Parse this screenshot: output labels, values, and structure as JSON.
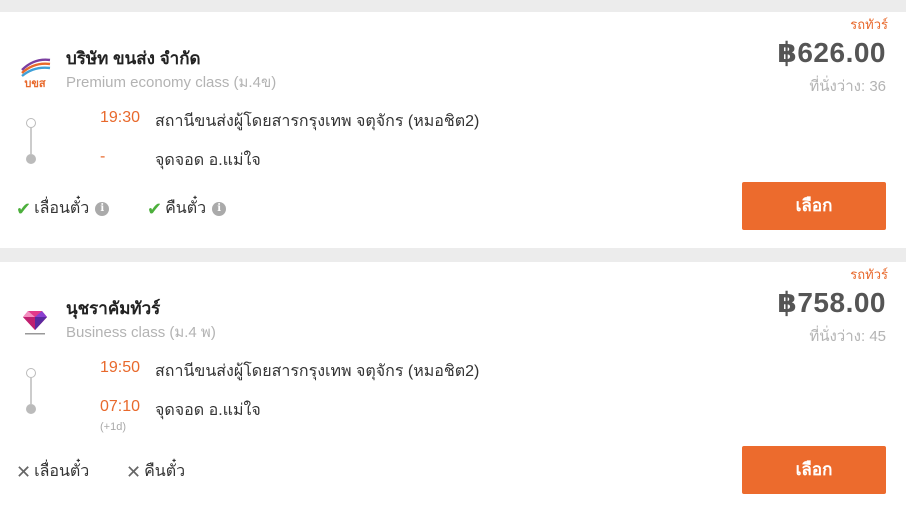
{
  "results": [
    {
      "badge": "รถทัวร์",
      "company": "บริษัท ขนส่ง จำกัด",
      "logo_icon": "bks-logo",
      "class_label": "Premium economy class (ม.4ข)",
      "price": "฿626.00",
      "seats": "ที่นั่งว่าง: 36",
      "departure_time": "19:30",
      "departure_place": "สถานีขนส่งผู้โดยสารกรุงเทพ จตุจักร (หมอชิต2)",
      "arrival_time": "-",
      "arrival_place": "จุดจอด อ.แม่ใจ",
      "next_day": "",
      "policy_reschedule": "เลื่อนตั๋ว",
      "policy_refund": "คืนตั๋ว",
      "reschedule_available": true,
      "refund_available": true,
      "select_label": "เลือก"
    },
    {
      "badge": "รถทัวร์",
      "company": "นุชราคัมทัวร์",
      "logo_icon": "diamond-logo",
      "class_label": "Business class (ม.4 พ)",
      "price": "฿758.00",
      "seats": "ที่นั่งว่าง: 45",
      "departure_time": "19:50",
      "departure_place": "สถานีขนส่งผู้โดยสารกรุงเทพ จตุจักร (หมอชิต2)",
      "arrival_time": "07:10",
      "arrival_place": "จุดจอด อ.แม่ใจ",
      "next_day": "(+1d)",
      "policy_reschedule": "เลื่อนตั๋ว",
      "policy_refund": "คืนตั๋ว",
      "reschedule_available": false,
      "refund_available": false,
      "select_label": "เลือก"
    }
  ],
  "colors": {
    "accent": "#ec6b2d",
    "check": "#4caf3c",
    "muted": "#b3b3b3"
  }
}
